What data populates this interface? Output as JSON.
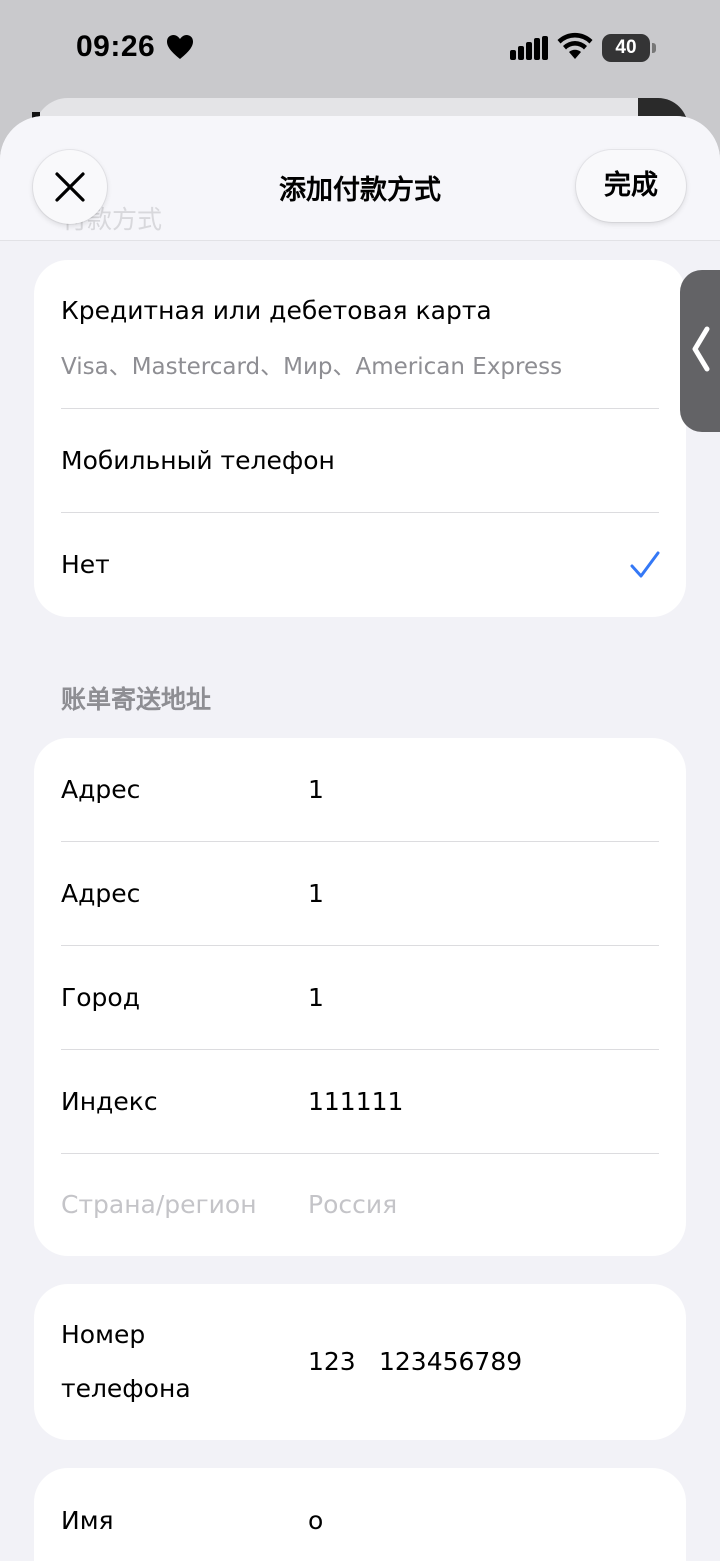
{
  "status_bar": {
    "time": "09:26",
    "battery_level": "40"
  },
  "nav": {
    "title": "添加付款方式",
    "done_label": "完成",
    "ghost_title": "付款方式"
  },
  "payment_methods": [
    {
      "title": "Кредитная или дебетовая карта",
      "subtitle": "Visa、Mastercard、Мир、American Express",
      "selected": false
    },
    {
      "title": "Мобильный телефон",
      "selected": false
    },
    {
      "title": "Нет",
      "selected": true
    }
  ],
  "billing": {
    "header": "账单寄送地址",
    "rows": [
      {
        "label": "Адрес",
        "value": "1"
      },
      {
        "label": "Адрес",
        "value": "1"
      },
      {
        "label": "Город",
        "value": "1"
      },
      {
        "label": "Индекс",
        "value": "111111"
      },
      {
        "label": "Страна/регион",
        "value": "Россия",
        "disabled": true
      }
    ]
  },
  "phone": {
    "label_line1": "Номер",
    "label_line2": "телефона",
    "code": "123",
    "number": "123456789"
  },
  "name": {
    "label": "Имя",
    "value": "о"
  },
  "colors": {
    "accent": "#3478f6",
    "sheet_bg": "#f2f2f7",
    "card_bg": "#ffffff",
    "secondary_text": "#8e8e93"
  }
}
